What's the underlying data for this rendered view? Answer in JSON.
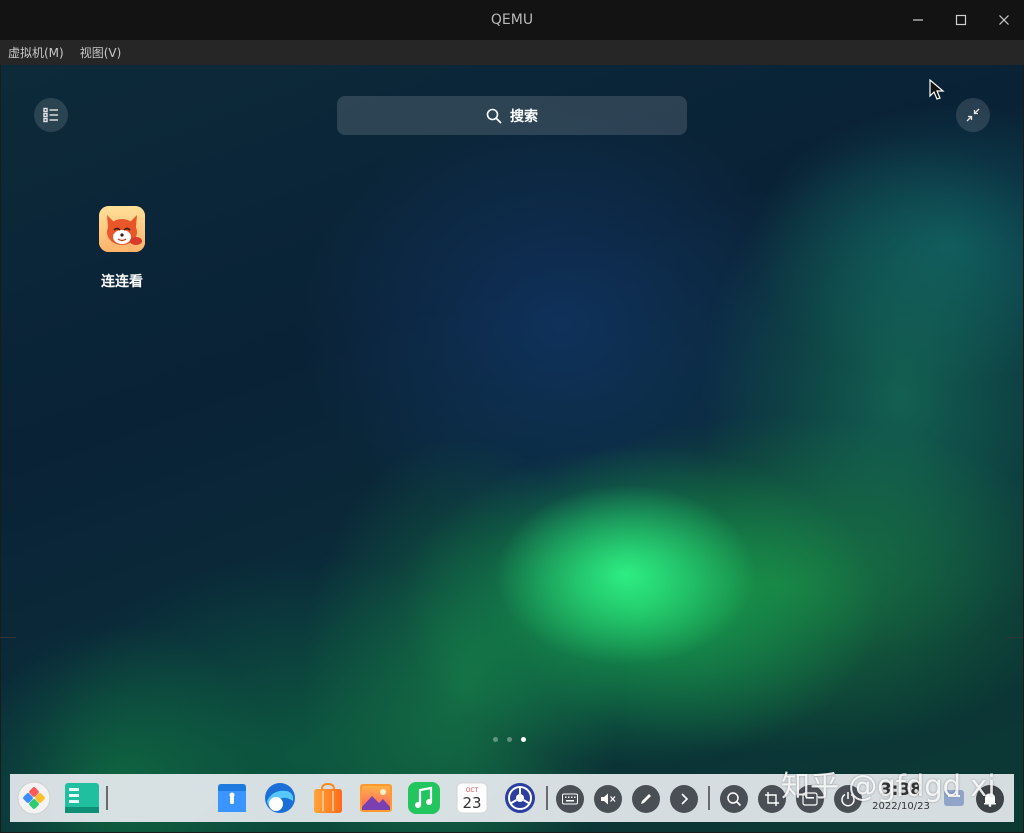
{
  "window": {
    "title": "QEMU"
  },
  "menubar": {
    "items": [
      "虚拟机(M)",
      "视图(V)"
    ]
  },
  "launcher": {
    "search_placeholder": "搜索",
    "apps": [
      {
        "label": "连连看",
        "icon": "fox-game-icon"
      }
    ],
    "pages": 3,
    "current_page": 3
  },
  "dock": {
    "apps": [
      {
        "name": "launcher",
        "icon": "launcher-icon"
      },
      {
        "name": "multitask-view",
        "icon": "multitask-icon"
      },
      {
        "name": "file-manager",
        "icon": "file-manager-icon"
      },
      {
        "name": "browser",
        "icon": "browser-icon"
      },
      {
        "name": "app-store",
        "icon": "app-store-icon"
      },
      {
        "name": "image-viewer",
        "icon": "image-viewer-icon"
      },
      {
        "name": "music",
        "icon": "music-icon"
      },
      {
        "name": "calendar",
        "icon": "calendar-icon",
        "month": "OCT",
        "day": "23"
      },
      {
        "name": "control-center",
        "icon": "control-center-icon"
      }
    ],
    "tray": [
      "keyboard-icon",
      "volume-muted-icon",
      "pen-icon",
      "chevron-right-icon",
      "search-icon",
      "screenshot-icon",
      "input-method-icon",
      "power-icon"
    ],
    "clock": {
      "time": "3:38",
      "date": "2022/10/23"
    }
  },
  "watermark": "知乎 @gfdgd xi",
  "colors": {
    "dock_bg": "#e8ecf0",
    "titlebar_bg": "#131313",
    "menubar_bg": "#262626"
  }
}
